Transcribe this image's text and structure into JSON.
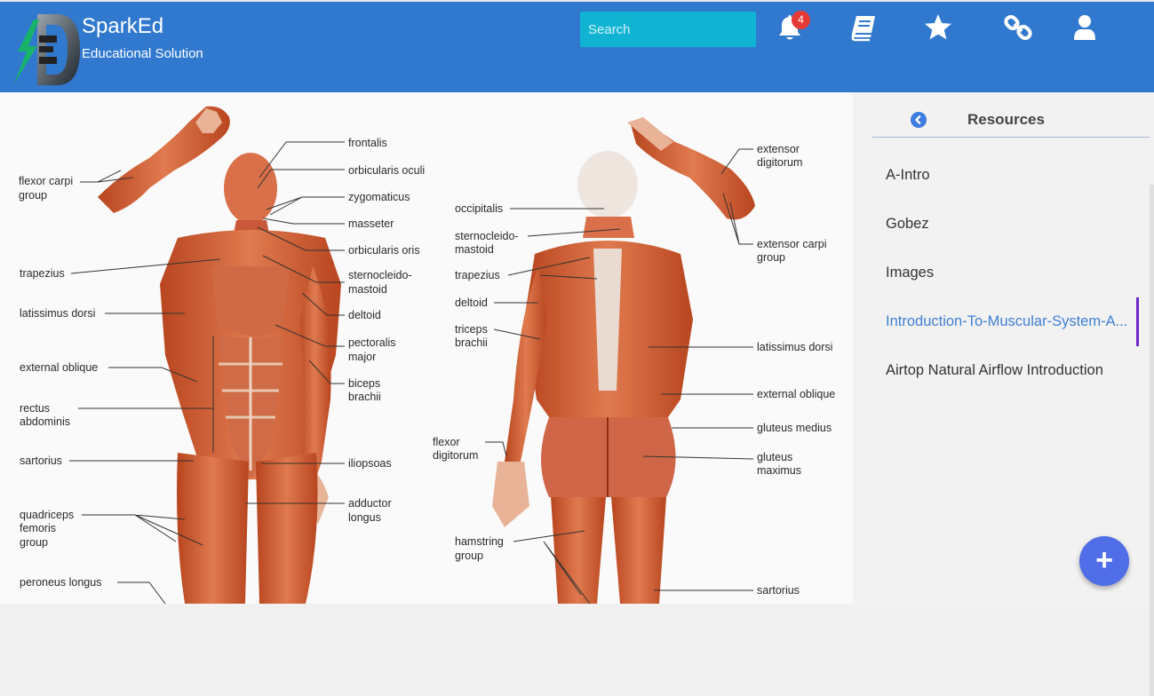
{
  "brand": {
    "name": "SparkEd",
    "tagline": "Educational Solution"
  },
  "search": {
    "placeholder": "Search",
    "value": ""
  },
  "nav": {
    "notification_count": "4",
    "icons": [
      "bell-icon",
      "book-icon",
      "star-icon",
      "link-icon",
      "user-icon"
    ]
  },
  "colors": {
    "header": "#3079cf",
    "search_bg": "#10b3d2",
    "badge": "#e53935",
    "accent_link": "#3f7fd4",
    "active_bar": "#6d28c9",
    "fab": "#4f6ee8"
  },
  "diagram": {
    "front_labels": {
      "frontalis": "frontalis",
      "orbicularis_oculi": "orbicularis oculi",
      "zygomaticus": "zygomaticus",
      "masseter": "masseter",
      "orbicularis_oris": "orbicularis oris",
      "sterno_1": "sternocleido-",
      "sterno_2": "mastoid",
      "deltoid": "deltoid",
      "pectoralis_1": "pectoralis",
      "pectoralis_2": "major",
      "biceps_1": "biceps",
      "biceps_2": "brachii",
      "iliopsoas": "iliopsoas",
      "adductor_1": "adductor",
      "adductor_2": "longus",
      "flexor_carpi_1": "flexor carpi",
      "flexor_carpi_2": "group",
      "trapezius": "trapezius",
      "latissimus": "latissimus dorsi",
      "external_oblique": "external oblique",
      "rectus_1": "rectus",
      "rectus_2": "abdominis",
      "sartorius": "sartorius",
      "quadriceps_1": "quadriceps",
      "quadriceps_2": "femoris",
      "quadriceps_3": "group",
      "peroneus": "peroneus longus"
    },
    "back_labels": {
      "occipitalis": "occipitalis",
      "sterno_1": "sternocleido-",
      "sterno_2": "mastoid",
      "trapezius": "trapezius",
      "deltoid": "deltoid",
      "triceps_1": "triceps",
      "triceps_2": "brachii",
      "flexor_dig_1": "flexor",
      "flexor_dig_2": "digitorum",
      "hamstring_1": "hamstring",
      "hamstring_2": "group",
      "extensor_dig_1": "extensor",
      "extensor_dig_2": "digitorum",
      "extensor_carpi_1": "extensor carpi",
      "extensor_carpi_2": "group",
      "latissimus": "latissimus dorsi",
      "external_oblique": "external oblique",
      "gluteus_medius": "gluteus medius",
      "gluteus_max_1": "gluteus",
      "gluteus_max_2": "maximus",
      "sartorius": "sartorius"
    }
  },
  "sidebar": {
    "title": "Resources",
    "items": [
      {
        "label": "A-Intro",
        "active": false
      },
      {
        "label": "Gobez",
        "active": false
      },
      {
        "label": "Images",
        "active": false
      },
      {
        "label": "Introduction-To-Muscular-System-A...",
        "active": true
      },
      {
        "label": "Airtop Natural Airflow Introduction",
        "active": false
      }
    ]
  },
  "fab": {
    "label": "+"
  }
}
